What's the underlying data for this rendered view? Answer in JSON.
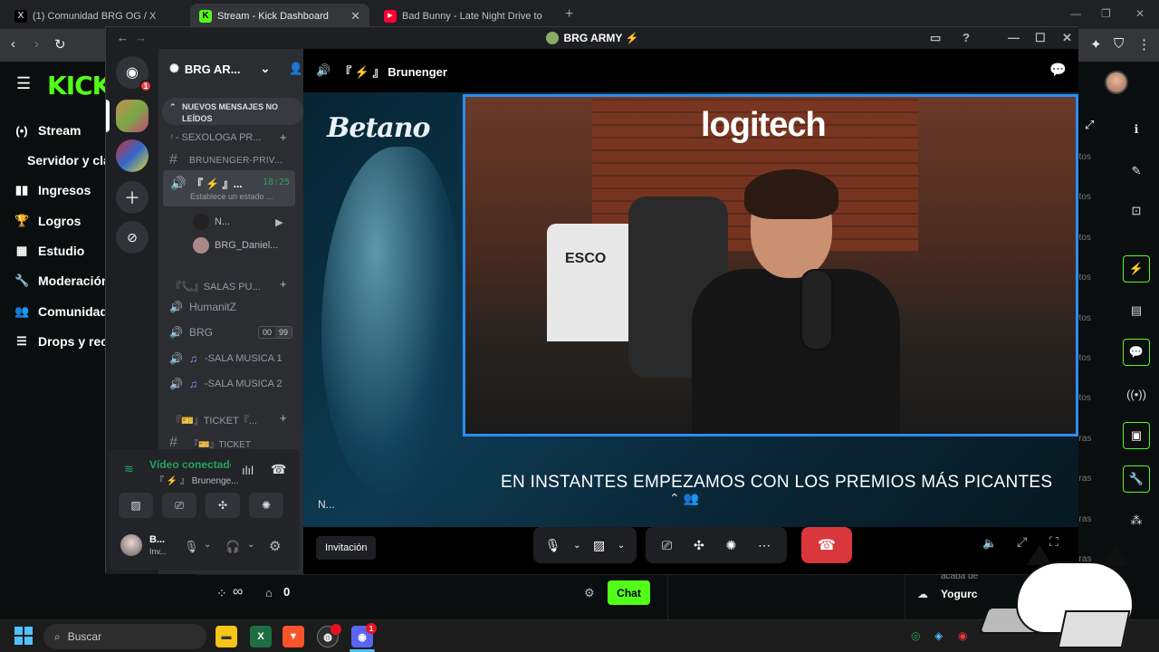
{
  "browser": {
    "tabs": [
      {
        "title": "(1) Comunidad BRG OG / X",
        "fav_color": "#000000",
        "fav_glyph": "X"
      },
      {
        "title": "Stream - Kick Dashboard",
        "fav_color": "#53fc18",
        "fav_glyph": "K"
      },
      {
        "title": "Bad Bunny - Late Night Drive to",
        "fav_color": "#ff0033",
        "fav_glyph": "▶"
      }
    ]
  },
  "kick": {
    "logo": "KICK",
    "nav": [
      {
        "label": "Stream",
        "icon": "(•)"
      },
      {
        "label": "Servidor y cla",
        "icon": ""
      },
      {
        "label": "Ingresos",
        "icon": "▮▮"
      },
      {
        "label": "Logros",
        "icon": "🏆"
      },
      {
        "label": "Estudio",
        "icon": "▦"
      },
      {
        "label": "Moderación",
        "icon": "🔧"
      },
      {
        "label": "Comunidad",
        "icon": "👥"
      },
      {
        "label": "Drops y rec",
        "icon": "☰"
      }
    ],
    "ago_labels": [
      "utos",
      "utos",
      "utos",
      "utos",
      "utos",
      "utos",
      "utos",
      "oras",
      "oras",
      "oras",
      "oras"
    ],
    "bottom": {
      "viewers": "∞",
      "count": "0",
      "chat_label": "Chat",
      "recent_user": "Yogurc",
      "recent_note": "acaba de"
    }
  },
  "discord": {
    "window_title": "BRG ARMY ⚡",
    "server_badge": "1",
    "server_name": "BRG AR...",
    "new_messages": "NUEVOS MENSAJES NO LEÍDOS",
    "channels": {
      "cat1": "ᵎ - SEXOLOGA PR...",
      "ch_private": "BRUNENGER-PRIV...",
      "active_vc": "『 ⚡ 』...",
      "active_time": "18:25",
      "active_status": "Establece un estado ...",
      "vc_user1": "N...",
      "vc_user2": "BRG_Daniel...",
      "cat2": "『📞』SALAS PU...",
      "vc_humanitz": "HumanitZ",
      "vc_brg": "BRG",
      "vc_brg_pill1": "00",
      "vc_brg_pill2": "99",
      "vc_musica1": "-SALA MUSICA 1",
      "vc_musica2": "-SALA MUSICA 2",
      "cat3": "『🎫』TICKET『...",
      "ch_ticket": "『🎫』TICKET"
    },
    "rtc": {
      "status": "Vídeo conectado",
      "sub": "『 ⚡ 』 Brunenge..."
    },
    "user": {
      "name": "B...",
      "status": "Inv..."
    },
    "header_channel": "『 ⚡ 』 Brunenger",
    "stream": {
      "sponsor": "Betano",
      "cam_brand": "logitech",
      "jersey": "ESCO",
      "caption": "EN INSTANTES EMPEZAMOS CON LOS PREMIOS MÁS PICANTES",
      "name_tag": "N..."
    },
    "controls": {
      "invite": "Invitación"
    }
  },
  "taskbar": {
    "search_placeholder": "Buscar",
    "discord_badge": "1"
  }
}
